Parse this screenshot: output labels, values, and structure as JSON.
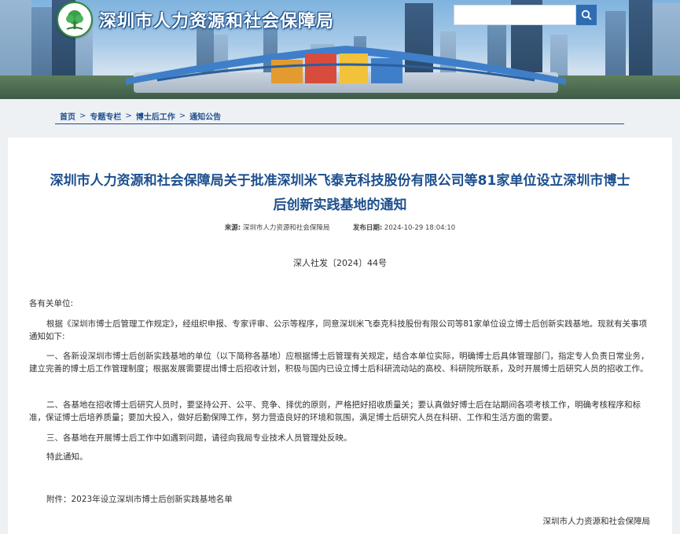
{
  "header": {
    "site_title": "深圳市人力资源和社会保障局",
    "search": {
      "placeholder": ""
    }
  },
  "breadcrumb": [
    "首页",
    "专题专栏",
    "博士后工作",
    "通知公告"
  ],
  "article": {
    "title": "深圳市人力资源和社会保障局关于批准深圳米飞泰克科技股份有限公司等81家单位设立深圳市博士后创新实践基地的通知",
    "source_label": "来源:",
    "source": "深圳市人力资源和社会保障局",
    "date_label": "发布日期:",
    "date": "2024-10-29 18:04:10",
    "doc_no": "深人社发〔2024〕44号",
    "salutation": "各有关单位:",
    "paragraphs": [
      "根据《深圳市博士后管理工作规定》，经组织申报、专家评审、公示等程序，同意深圳米飞泰克科技股份有限公司等81家单位设立博士后创新实践基地。现就有关事项通知如下:",
      "一、各新设深圳市博士后创新实践基地的单位（以下简称各基地）应根据博士后管理有关规定，结合本单位实际，明确博士后具体管理部门，指定专人负责日常业务，建立完善的博士后工作管理制度；根据发展需要提出博士后招收计划，积极与国内已设立博士后科研流动站的高校、科研院所联系，及时开展博士后研究人员的招收工作。",
      "二、各基地在招收博士后研究人员时，要坚持公开、公平、竞争、择优的原则，严格把好招收质量关；要认真做好博士后在站期间各项考核工作，明确考核程序和标准，保证博士后培养质量；要加大投入，做好后勤保障工作，努力营造良好的环境和氛围，满足博士后研究人员在科研、工作和生活方面的需要。",
      "三、各基地在开展博士后工作中如遇到问题，请径向我局专业技术人员管理处反映。",
      "特此通知。"
    ],
    "attachment": "附件：2023年设立深圳市博士后创新实践基地名单",
    "signature": "深圳市人力资源和社会保障局"
  },
  "colors": {
    "title_blue": "#1d4f8e",
    "search_button": "#2f6db3",
    "logo_green": "#2e8b3e"
  },
  "icons": [
    "logo-emblem-icon",
    "search-icon",
    "breadcrumb-separator-icon"
  ]
}
